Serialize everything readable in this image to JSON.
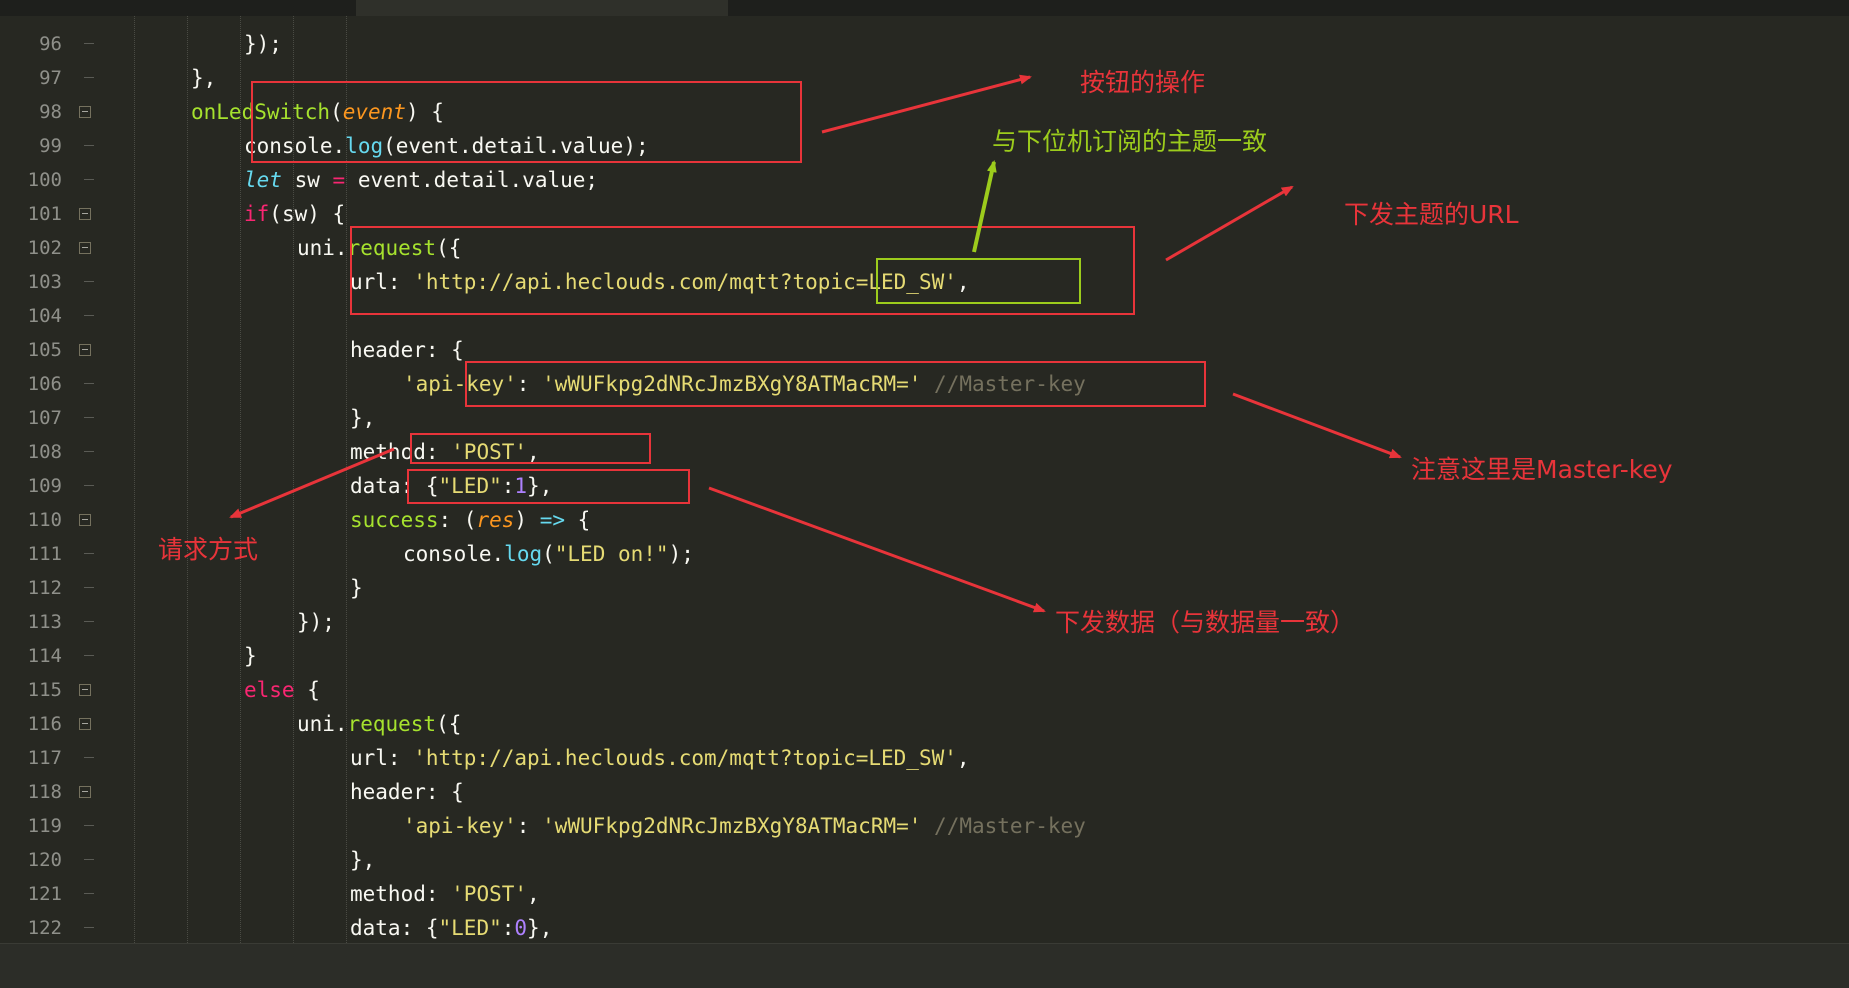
{
  "lines": [
    {
      "n": "96",
      "indent": 3,
      "fold": false,
      "tokens": [
        [
          "p",
          "});"
        ]
      ]
    },
    {
      "n": "97",
      "indent": 2,
      "fold": false,
      "tokens": [
        [
          "p",
          "},"
        ]
      ]
    },
    {
      "n": "98",
      "indent": 2,
      "fold": true,
      "tokens": [
        [
          "f",
          "onLedSwitch"
        ],
        [
          "p",
          "("
        ],
        [
          "par",
          "event"
        ],
        [
          "p",
          ") {"
        ]
      ]
    },
    {
      "n": "99",
      "indent": 3,
      "fold": false,
      "tokens": [
        [
          "p",
          "console"
        ],
        [
          "p",
          "."
        ],
        [
          "fb",
          "log"
        ],
        [
          "p",
          "(event.detail.value);"
        ]
      ]
    },
    {
      "n": "100",
      "indent": 3,
      "fold": false,
      "tokens": [
        [
          "t",
          "let"
        ],
        [
          "p",
          " sw "
        ],
        [
          "k",
          "="
        ],
        [
          "p",
          " event.detail.value;"
        ]
      ]
    },
    {
      "n": "101",
      "indent": 3,
      "fold": true,
      "tokens": [
        [
          "k",
          "if"
        ],
        [
          "p",
          "(sw) {"
        ]
      ]
    },
    {
      "n": "102",
      "indent": 4,
      "fold": true,
      "tokens": [
        [
          "p",
          "uni."
        ],
        [
          "f",
          "request"
        ],
        [
          "p",
          "({"
        ]
      ]
    },
    {
      "n": "103",
      "indent": 5,
      "fold": false,
      "tokens": [
        [
          "p",
          "url: "
        ],
        [
          "s",
          "'http://api.heclouds.com/mqtt?topic=LED_SW'"
        ],
        [
          "p",
          ","
        ]
      ]
    },
    {
      "n": "104",
      "indent": 5,
      "fold": false,
      "tokens": []
    },
    {
      "n": "105",
      "indent": 5,
      "fold": true,
      "tokens": [
        [
          "p",
          "header: {"
        ]
      ]
    },
    {
      "n": "106",
      "indent": 6,
      "fold": false,
      "tokens": [
        [
          "s",
          "'api-key'"
        ],
        [
          "p",
          ": "
        ],
        [
          "s",
          "'wWUFkpg2dNRcJmzBXgY8ATMacRM='"
        ],
        [
          "p",
          " "
        ],
        [
          "c",
          "//Master-key"
        ]
      ]
    },
    {
      "n": "107",
      "indent": 5,
      "fold": false,
      "tokens": [
        [
          "p",
          "},"
        ]
      ]
    },
    {
      "n": "108",
      "indent": 5,
      "fold": false,
      "tokens": [
        [
          "p",
          "method: "
        ],
        [
          "s",
          "'POST'"
        ],
        [
          "p",
          ","
        ]
      ]
    },
    {
      "n": "109",
      "indent": 5,
      "fold": false,
      "tokens": [
        [
          "p",
          "data: {"
        ],
        [
          "s",
          "\"LED\""
        ],
        [
          "p",
          ":"
        ],
        [
          "n",
          "1"
        ],
        [
          "p",
          "},"
        ]
      ]
    },
    {
      "n": "110",
      "indent": 5,
      "fold": true,
      "tokens": [
        [
          "f",
          "success"
        ],
        [
          "p",
          ": ("
        ],
        [
          "par",
          "res"
        ],
        [
          "p",
          ") "
        ],
        [
          "fb",
          "=>"
        ],
        [
          "p",
          " {"
        ]
      ]
    },
    {
      "n": "111",
      "indent": 6,
      "fold": false,
      "tokens": [
        [
          "p",
          "console"
        ],
        [
          "p",
          "."
        ],
        [
          "fb",
          "log"
        ],
        [
          "p",
          "("
        ],
        [
          "s",
          "\"LED on!\""
        ],
        [
          "p",
          ");"
        ]
      ]
    },
    {
      "n": "112",
      "indent": 5,
      "fold": false,
      "tokens": [
        [
          "p",
          "}"
        ]
      ]
    },
    {
      "n": "113",
      "indent": 4,
      "fold": false,
      "tokens": [
        [
          "p",
          "});"
        ]
      ]
    },
    {
      "n": "114",
      "indent": 3,
      "fold": false,
      "tokens": [
        [
          "p",
          "}"
        ]
      ]
    },
    {
      "n": "115",
      "indent": 3,
      "fold": true,
      "tokens": [
        [
          "k",
          "else"
        ],
        [
          "p",
          " {"
        ]
      ]
    },
    {
      "n": "116",
      "indent": 4,
      "fold": true,
      "tokens": [
        [
          "p",
          "uni."
        ],
        [
          "f",
          "request"
        ],
        [
          "p",
          "({"
        ]
      ]
    },
    {
      "n": "117",
      "indent": 5,
      "fold": false,
      "tokens": [
        [
          "p",
          "url: "
        ],
        [
          "s",
          "'http://api.heclouds.com/mqtt?topic=LED_SW'"
        ],
        [
          "p",
          ","
        ]
      ]
    },
    {
      "n": "118",
      "indent": 5,
      "fold": true,
      "tokens": [
        [
          "p",
          "header: {"
        ]
      ]
    },
    {
      "n": "119",
      "indent": 6,
      "fold": false,
      "tokens": [
        [
          "s",
          "'api-key'"
        ],
        [
          "p",
          ": "
        ],
        [
          "s",
          "'wWUFkpg2dNRcJmzBXgY8ATMacRM='"
        ],
        [
          "p",
          " "
        ],
        [
          "c",
          "//Master-key"
        ]
      ]
    },
    {
      "n": "120",
      "indent": 5,
      "fold": false,
      "tokens": [
        [
          "p",
          "},"
        ]
      ]
    },
    {
      "n": "121",
      "indent": 5,
      "fold": false,
      "tokens": [
        [
          "p",
          "method: "
        ],
        [
          "s",
          "'POST'"
        ],
        [
          "p",
          ","
        ]
      ]
    },
    {
      "n": "122",
      "indent": 5,
      "fold": false,
      "tokens": [
        [
          "p",
          "data: {"
        ],
        [
          "s",
          "\"LED\""
        ],
        [
          "p",
          ":"
        ],
        [
          "n",
          "0"
        ],
        [
          "p",
          "},"
        ]
      ]
    }
  ],
  "annotations": {
    "button_action": "按钮的操作",
    "topic_match": "与下位机订阅的主题一致",
    "topic_url": "下发主题的URL",
    "master_key": "注意这里是Master-key",
    "request_method": "请求方式",
    "send_data": "下发数据（与数据量一致）"
  },
  "colors": {
    "background": "#272822",
    "annotation_red": "#e8343a",
    "annotation_green": "#9ccc1c",
    "keyword": "#f92672",
    "string": "#e6db74",
    "function": "#a6e22e"
  }
}
